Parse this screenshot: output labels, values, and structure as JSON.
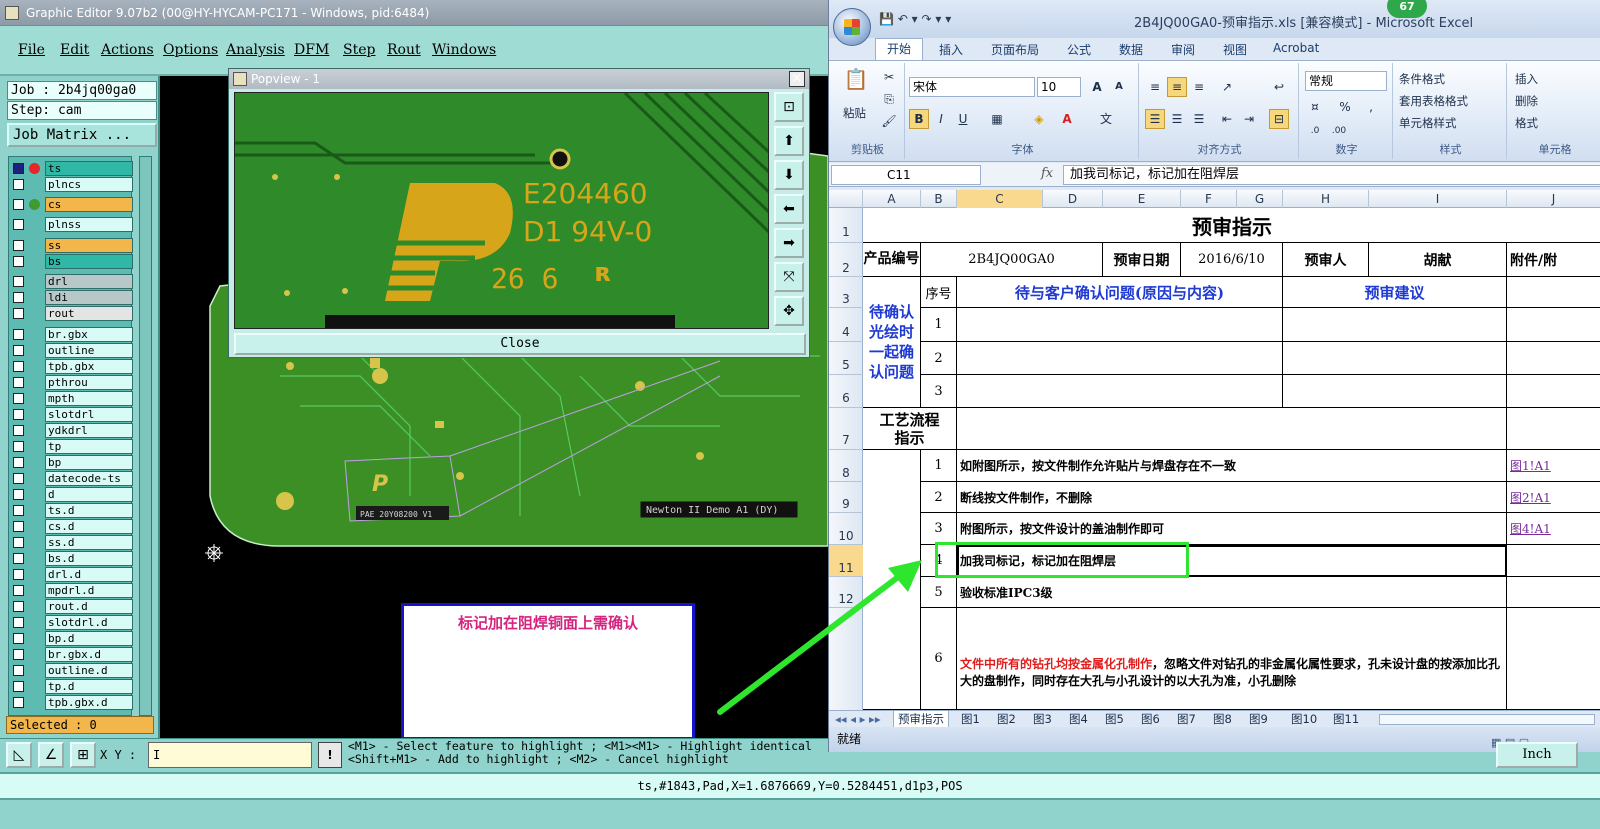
{
  "ge": {
    "title": "Graphic Editor 9.07b2 (00@HY-HYCAM-PC171 - Windows, pid:6484)",
    "menu": [
      "File",
      "Edit",
      "Actions",
      "Options",
      "Analysis",
      "DFM",
      "Step",
      "Rout",
      "Windows"
    ],
    "job": "Job : 2b4jq00ga0",
    "step": "Step: cam",
    "job_matrix": "Job Matrix ...",
    "layers": [
      {
        "name": "ts",
        "color": "#2fb8a6",
        "dot": "#e8262a"
      },
      {
        "name": "plncs",
        "color": "#d9fbf6",
        "dot": ""
      },
      {
        "name": "cs",
        "color": "#f2b64a",
        "dot": "#3f9a2f"
      },
      {
        "name": "plnss",
        "color": "#d9fbf6",
        "dot": ""
      },
      {
        "name": "ss",
        "color": "#f2b64a",
        "dot": ""
      },
      {
        "name": "bs",
        "color": "#2fb8a6",
        "dot": ""
      },
      {
        "name": "drl",
        "color": "#b8c8c8",
        "dot": ""
      },
      {
        "name": "ldi",
        "color": "#b8c8c8",
        "dot": ""
      },
      {
        "name": "rout",
        "color": "#e4e4e4",
        "dot": ""
      },
      {
        "name": "br.gbx",
        "color": "#d9fbf6",
        "dot": ""
      },
      {
        "name": "outline",
        "color": "#d9fbf6",
        "dot": ""
      },
      {
        "name": "tpb.gbx",
        "color": "#d9fbf6",
        "dot": ""
      },
      {
        "name": "pthrou",
        "color": "#d9fbf6",
        "dot": ""
      },
      {
        "name": "mpth",
        "color": "#d9fbf6",
        "dot": ""
      },
      {
        "name": "slotdrl",
        "color": "#d9fbf6",
        "dot": ""
      },
      {
        "name": "ydkdrl",
        "color": "#d9fbf6",
        "dot": ""
      },
      {
        "name": "tp",
        "color": "#d9fbf6",
        "dot": ""
      },
      {
        "name": "bp",
        "color": "#d9fbf6",
        "dot": ""
      },
      {
        "name": "datecode-ts",
        "color": "#d9fbf6",
        "dot": ""
      },
      {
        "name": "d",
        "color": "#d9fbf6",
        "dot": ""
      },
      {
        "name": "ts.d",
        "color": "#d9fbf6",
        "dot": ""
      },
      {
        "name": "cs.d",
        "color": "#d9fbf6",
        "dot": ""
      },
      {
        "name": "ss.d",
        "color": "#d9fbf6",
        "dot": ""
      },
      {
        "name": "bs.d",
        "color": "#d9fbf6",
        "dot": ""
      },
      {
        "name": "drl.d",
        "color": "#d9fbf6",
        "dot": ""
      },
      {
        "name": "mpdrl.d",
        "color": "#d9fbf6",
        "dot": ""
      },
      {
        "name": "rout.d",
        "color": "#d9fbf6",
        "dot": ""
      },
      {
        "name": "slotdrl.d",
        "color": "#d9fbf6",
        "dot": ""
      },
      {
        "name": "bp.d",
        "color": "#d9fbf6",
        "dot": ""
      },
      {
        "name": "br.gbx.d",
        "color": "#d9fbf6",
        "dot": ""
      },
      {
        "name": "outline.d",
        "color": "#d9fbf6",
        "dot": ""
      },
      {
        "name": "tp.d",
        "color": "#d9fbf6",
        "dot": ""
      },
      {
        "name": "tpb.gbx.d",
        "color": "#d9fbf6",
        "dot": ""
      }
    ],
    "selected": "Selected : 0",
    "xy_label": "X Y :",
    "xy_value": "I",
    "hint_btn": "!",
    "hint1": "<M1> - Select feature to highlight ; <M1><M1> - Highlight identical",
    "hint2": "<Shift+M1> - Add to highlight ; <M2> - Cancel highlight",
    "status": "ts,#1843,Pad,X=1.6876669,Y=0.5284451,d1p3,POS",
    "units": "Inch",
    "board_label": "Newton II Demo A1 (DY)",
    "canvas_small": "PAE 20Y08200 V1"
  },
  "popview": {
    "title": "Popview - 1",
    "close": "Close",
    "marking_line1": "E204460",
    "marking_line2": "D1  94V-0",
    "marking_line3": "26 6",
    "logo": "P"
  },
  "annotation": "标记加在阻焊铜面上需确认",
  "excel": {
    "title": "2B4JQ00GA0-预审指示.xls  [兼容模式] - Microsoft Excel",
    "badge": "67",
    "tabs": [
      "开始",
      "插入",
      "页面布局",
      "公式",
      "数据",
      "审阅",
      "视图",
      "Acrobat"
    ],
    "groups": {
      "clipboard": "剪贴板",
      "font": "字体",
      "align": "对齐方式",
      "number": "数字",
      "styles": "样式",
      "cells": "单元格"
    },
    "paste": "粘贴",
    "font_name": "宋体",
    "font_size": "10",
    "number_format": "常规",
    "cond_format": "条件格式",
    "table_format": "套用表格格式",
    "cell_style": "单元格样式",
    "insert": "插入",
    "delete": "删除",
    "format": "格式",
    "namebox": "C11",
    "fx": "fx",
    "formula": "加我司标记，标记加在阻焊层",
    "columns": [
      "A",
      "B",
      "C",
      "D",
      "E",
      "F",
      "G",
      "H",
      "I",
      "J"
    ],
    "rows": [
      "1",
      "2",
      "3",
      "4",
      "5",
      "6",
      "7",
      "8",
      "9",
      "10",
      "11",
      "12"
    ],
    "cells": {
      "title": "预审指示",
      "pn_label": "产品编号",
      "pn": "2B4JQ00GA0",
      "date_label": "预审日期",
      "date": "2016/6/10",
      "reviewer_label": "预审人",
      "reviewer": "胡献",
      "attach": "附件/附",
      "pending": "待确认光绘时一起确认问题",
      "seq": "序号",
      "question": "待与客户确认问题(原因与内容)",
      "suggest": "预审建议",
      "n1": "1",
      "n2": "2",
      "n3": "3",
      "process": "工艺流程指示",
      "p1": "1",
      "p1t": "如附图所示，按文件制作允许贴片与焊盘存在不一致",
      "p1l": "图1!A1",
      "p2": "2",
      "p2t": "断线按文件制作，不删除",
      "p2l": "图2!A1",
      "p3": "3",
      "p3t": "附图所示，按文件设计的盖油制作即可",
      "p3l": "图4!A1",
      "p4": "4",
      "p4t": "加我司标记，标记加在阻焊层",
      "p5": "5",
      "p5t": "验收标准IPC3级",
      "p6": "6",
      "p6red": "文件中所有的钻孔均按金属化孔制作",
      "p6t": "，忽略文件对钻孔的非金属化属性要求，孔未设计盘的按添加比孔大的盘制作，同时存在大孔与小孔设计的以大孔为准，小孔删除"
    },
    "sheets": [
      "预审指示",
      "图1",
      "图2",
      "图3",
      "图4",
      "图5",
      "图6",
      "图7",
      "图8",
      "图9",
      "图10",
      "图11"
    ],
    "status": "就绪"
  },
  "colors": {
    "accent": "#1e3ad2",
    "highlight": "#2ee62e",
    "annot": "#d4247f"
  }
}
